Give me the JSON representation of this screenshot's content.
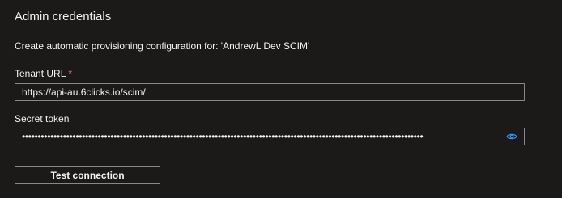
{
  "section": {
    "title": "Admin credentials",
    "description": "Create automatic provisioning configuration for: 'AndrewL Dev SCIM'"
  },
  "tenant_url": {
    "label": "Tenant URL",
    "required_marker": "*",
    "value": "https://api-au.6clicks.io/scim/"
  },
  "secret_token": {
    "label": "Secret token",
    "masked_value": "•••••••••••••••••••••••••••••••••••••••••••••••••••••••••••••••••••••••••••••••••••••••••••••••••••••••••••••••••••••••••••••••",
    "reveal_icon": "eye-icon"
  },
  "actions": {
    "test_connection_label": "Test connection"
  },
  "colors": {
    "background": "#1b1a19",
    "border": "#8a8886",
    "required": "#f1707b",
    "accent": "#2899f5"
  }
}
